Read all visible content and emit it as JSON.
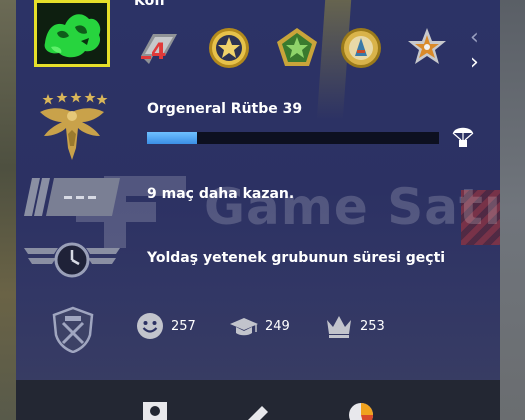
{
  "profile": {
    "username": "Kofi",
    "avatar_icon": "avatar-image",
    "avatar_frame_color": "#e6e02a"
  },
  "medals": [
    {
      "name": "service-medal-4-icon"
    },
    {
      "name": "gold-coin-medal-icon"
    },
    {
      "name": "green-star-medal-icon"
    },
    {
      "name": "gold-map-coin-icon"
    },
    {
      "name": "silver-star-medal-icon"
    }
  ],
  "rank": {
    "label": "Orgeneral Rütbe 39",
    "progress": 0.17,
    "progress_color": "#4fa6f2",
    "emblem_icon": "eagle-rank-emblem-icon",
    "reward_icon": "parachute-drop-icon"
  },
  "status_rows": {
    "wins_needed": "9 maç daha kazan.",
    "skill_group_expired": "Yoldaş yetenek grubunun süresi geçti"
  },
  "watermark": {
    "text": "Game Satış"
  },
  "commendations": [
    {
      "icon": "smiley-icon",
      "value": "257"
    },
    {
      "icon": "graduation-cap-icon",
      "value": "249"
    },
    {
      "icon": "crown-icon",
      "value": "253"
    }
  ],
  "colors": {
    "panel_bg": "#2c3366",
    "footer_bg": "#232733",
    "text": "#ffffff"
  }
}
